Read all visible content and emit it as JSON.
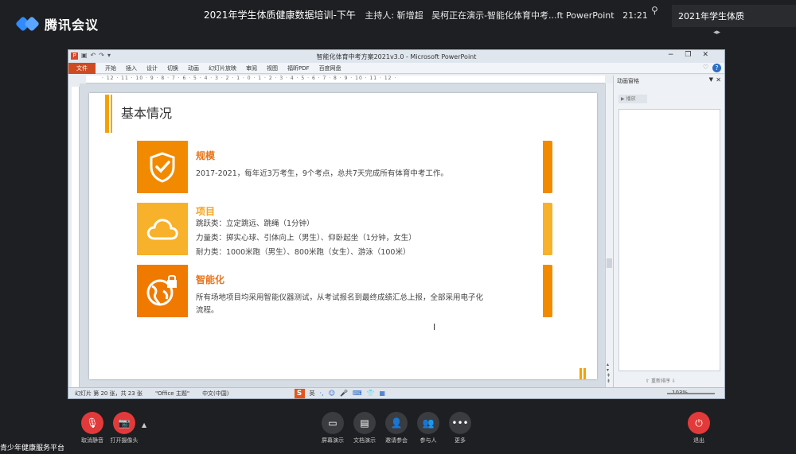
{
  "meeting": {
    "brand": "腾讯会议",
    "title": "2021年学生体质健康数据培训-下午",
    "host": "主持人: 靳增超",
    "presenting": "吴柯正在演示-智能化体育中考...ft PowerPoint",
    "time": "21:21",
    "corner_title": "2021年学生体质",
    "channel": "青少年健康服务平台"
  },
  "ppt": {
    "window_title": "智能化体育中考方案2021v3.0 - Microsoft PowerPoint",
    "ribbon_tabs": [
      "文件",
      "开始",
      "插入",
      "设计",
      "切换",
      "动画",
      "幻灯片放映",
      "审阅",
      "视图",
      "福昕PDF",
      "百度网盘"
    ],
    "ruler": "· 12 · 11 · 10 · 9 · 8 · 7 · 6 · 5 · 4 · 3 · 2 · 1 · 0 · 1 · 2 · 3 · 4 · 5 · 6 · 7 · 8 · 9 · 10 · 11 · 12 ·",
    "anim_pane": {
      "title": "动画窗格",
      "play": "播放",
      "reorder": "重新排序"
    },
    "status": {
      "slide": "幻灯片 第 20 张，共 23 张",
      "theme": "\"Office 主题\"",
      "lang": "中文(中国)",
      "ime": "英",
      "zoom": "103%"
    }
  },
  "slide": {
    "title": "基本情况",
    "items": [
      {
        "head": "规模",
        "head_color": "#e8741a",
        "lines": [
          "2017-2021，每年近3万考生，9个考点，总共7天完成所有体育中考工作。"
        ]
      },
      {
        "head": "项目",
        "head_color": "#f2a51c",
        "lines": [
          "跳跃类：立定跳远、跳绳（1分钟）",
          "力量类：掷实心球、引体向上（男生）、仰卧起坐（1分钟，女生）",
          "耐力类：1000米跑（男生）、800米跑（女生）、游泳（100米）"
        ]
      },
      {
        "head": "智能化",
        "head_color": "#e8741a",
        "lines": [
          "所有场地项目均采用智能仪器测试，从考试报名到最终成绩汇总上报，全部采用电子化",
          "流程。"
        ]
      }
    ]
  },
  "toolbar": {
    "buttons": [
      "取消静音",
      "打开摄像头",
      "屏幕演示",
      "文档演示",
      "邀请参会",
      "参与人",
      "更多",
      "退出"
    ]
  },
  "icons": {
    "item1": "shield-check-icon",
    "item2": "cloud-icon",
    "item3": "globe-lock-icon"
  }
}
